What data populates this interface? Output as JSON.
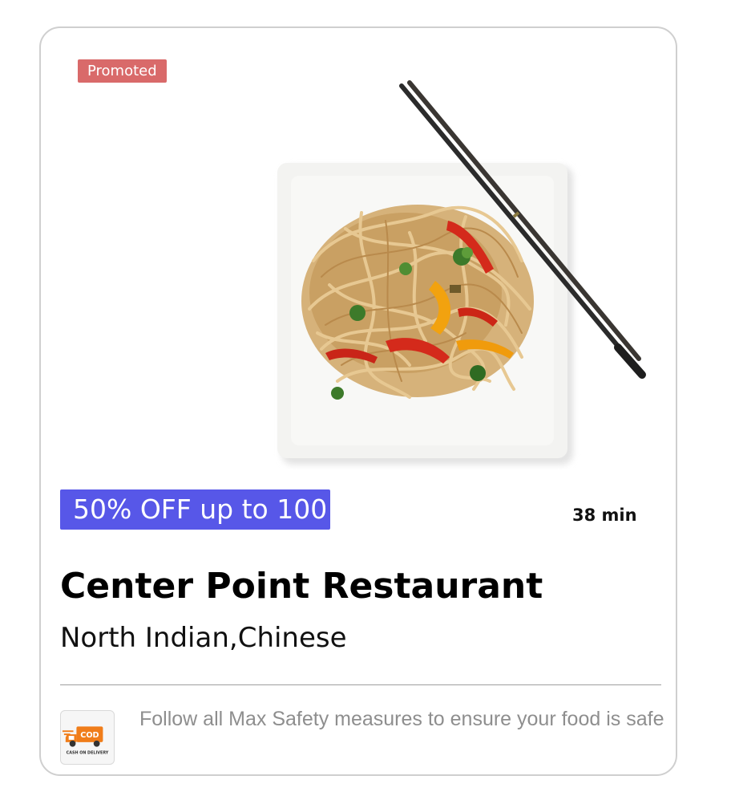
{
  "card": {
    "badge": "Promoted",
    "offer": "50% OFF up to 100",
    "eta": "38 min",
    "restaurant_name": "Center Point Restaurant",
    "cuisines": "North Indian,Chinese",
    "safety_text": "Follow all Max Safety measures to ensure your food is safe",
    "cod_badge_text": "COD",
    "cod_caption": "CASH ON DELIVERY"
  },
  "colors": {
    "promoted_bg": "#d96a6a",
    "offer_bg": "#5757e8",
    "cod_orange": "#f07d1a"
  },
  "icons": {
    "food": "noodles-plate-image",
    "cod": "cash-on-delivery-truck-icon"
  }
}
